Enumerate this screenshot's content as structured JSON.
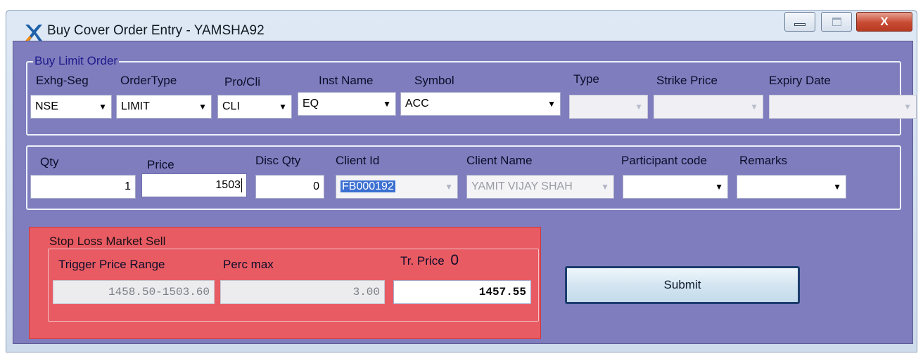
{
  "window": {
    "title": "Buy Cover Order Entry - YAMSHA92",
    "icon": "app-logo-icon",
    "controls": {
      "minimize": "minimize-icon",
      "maximize": "maximize-icon",
      "close_label": "X"
    }
  },
  "buy_limit_order": {
    "group_title": "Buy Limit Order",
    "labels": {
      "exhg_seg": "Exhg-Seg",
      "order_type": "OrderType",
      "pro_cli": "Pro/Cli",
      "inst_name": "Inst Name",
      "symbol": "Symbol",
      "type": "Type",
      "strike_price": "Strike Price",
      "expiry_date": "Expiry Date"
    },
    "values": {
      "exhg_seg": "NSE",
      "order_type": "LIMIT",
      "pro_cli": "CLI",
      "inst_name": "EQ",
      "symbol": "ACC",
      "type": "",
      "strike_price": "",
      "expiry_date": ""
    }
  },
  "order_details": {
    "labels": {
      "qty": "Qty",
      "price": "Price",
      "disc_qty": "Disc Qty",
      "client_id": "Client Id",
      "client_name": "Client Name",
      "participant_code": "Participant code",
      "remarks": "Remarks"
    },
    "values": {
      "qty": "1",
      "price": "1503",
      "disc_qty": "0",
      "client_id": "FB000192",
      "client_name": "YAMIT VIJAY SHAH",
      "participant_code": "",
      "remarks": ""
    }
  },
  "stop_loss": {
    "title": "Stop Loss Market Sell",
    "labels": {
      "trigger_price_range": "Trigger Price Range",
      "perc_max": "Perc max",
      "tr_price": "Tr. Price",
      "tr_price_indicator": "0"
    },
    "values": {
      "trigger_price_range": "1458.50-1503.60",
      "perc_max": "3.00",
      "tr_price": "1457.55"
    }
  },
  "actions": {
    "submit_label": "Submit"
  },
  "colors": {
    "client_background": "#7f7dbd",
    "stop_loss_panel": "#e95b63",
    "group_title_text": "#1e1a8c",
    "selection": "#3b6fd1"
  }
}
